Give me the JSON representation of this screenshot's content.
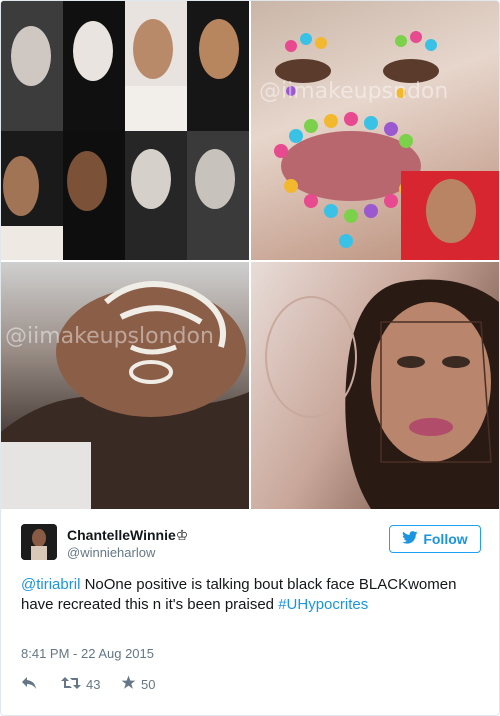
{
  "media_watermarks": [
    "@iimakeupsndon",
    "@iimakeupslondon"
  ],
  "author": {
    "display_name": "ChantelleWinnie♔",
    "handle": "@winnieharlow"
  },
  "follow_label": "Follow",
  "tweet": {
    "mention": "@tiriabril",
    "text": " NoOne positive is talking bout black face BLACKwomen have recreated this n it's been praised ",
    "hashtag": "#UHypocrites",
    "timestamp": "8:41 PM - 22 Aug 2015"
  },
  "stats": {
    "retweets": "43",
    "likes": "50"
  },
  "colors": {
    "link": "#1b95e0",
    "muted": "#657786",
    "text": "#14171a"
  },
  "icons": [
    "twitter-bird-icon",
    "reply-icon",
    "retweet-icon",
    "star-icon"
  ]
}
